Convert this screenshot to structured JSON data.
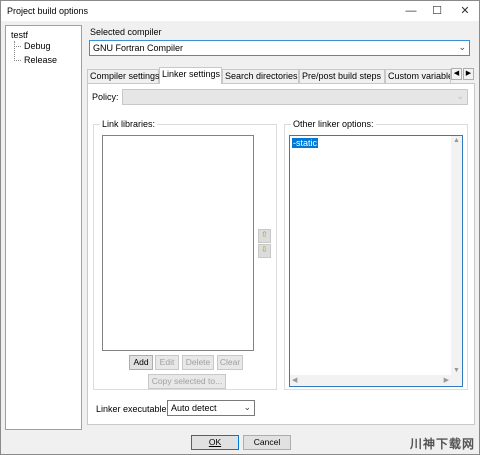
{
  "window": {
    "title": "Project build options",
    "minimize_glyph": "—",
    "maximize_glyph": "☐",
    "close_glyph": "✕"
  },
  "tree": {
    "root": "testf",
    "children": [
      "Debug",
      "Release"
    ]
  },
  "compiler": {
    "label": "Selected compiler",
    "value": "GNU Fortran Compiler"
  },
  "tabs": [
    "Compiler settings",
    "Linker settings",
    "Search directories",
    "Pre/post build steps",
    "Custom variable"
  ],
  "active_tab": "Linker settings",
  "policy": {
    "label": "Policy:",
    "value": ""
  },
  "link_libraries": {
    "title": "Link libraries:",
    "items": [],
    "buttons": {
      "add": "Add",
      "edit": "Edit",
      "delete": "Delete",
      "clear": "Clear",
      "copy": "Copy selected to..."
    }
  },
  "other_options": {
    "title": "Other linker options:",
    "value": "-static"
  },
  "linker_executable": {
    "label": "Linker executable:",
    "value": "Auto detect"
  },
  "footer": {
    "ok": "OK",
    "cancel": "Cancel"
  },
  "watermark": "川神下载网"
}
